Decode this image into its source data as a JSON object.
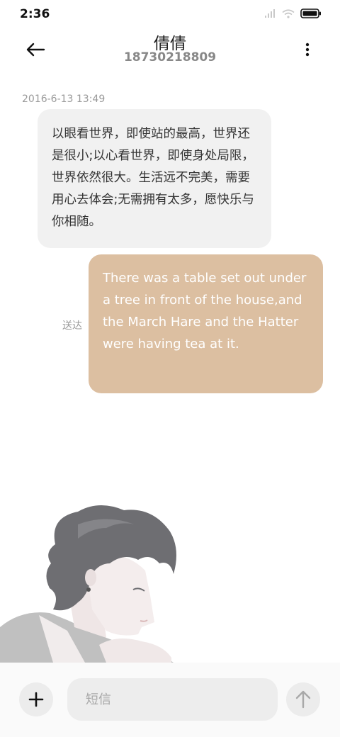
{
  "status_bar": {
    "time": "2:36",
    "icons": [
      "signal-icon",
      "wifi-icon",
      "battery-icon"
    ]
  },
  "header": {
    "contact_name": "倩倩",
    "contact_number": "18730218809",
    "back_icon": "arrow-left-icon",
    "menu_icon": "more-vertical-icon"
  },
  "conversation": {
    "timestamp": "2016-6-13 13:49",
    "messages": [
      {
        "direction": "incoming",
        "text": "以眼看世界，即使站的最高，世界还是很小;以心看世界，即使身处局限，世界依然很大。生活远不完美，需要用心去体会;无需拥有太多，愿快乐与你相随。"
      },
      {
        "direction": "outgoing",
        "text": "There was a table set out under a tree in front of the house,and the March Hare and the Hatter were having tea at it.",
        "status": "送达"
      }
    ]
  },
  "composer": {
    "placeholder": "短信",
    "value": "",
    "add_icon": "plus-icon",
    "send_icon": "arrow-up-icon"
  },
  "colors": {
    "incoming_bubble": "#f1f1f1",
    "outgoing_bubble": "#dcbfa1",
    "outgoing_text": "#ffffff"
  }
}
